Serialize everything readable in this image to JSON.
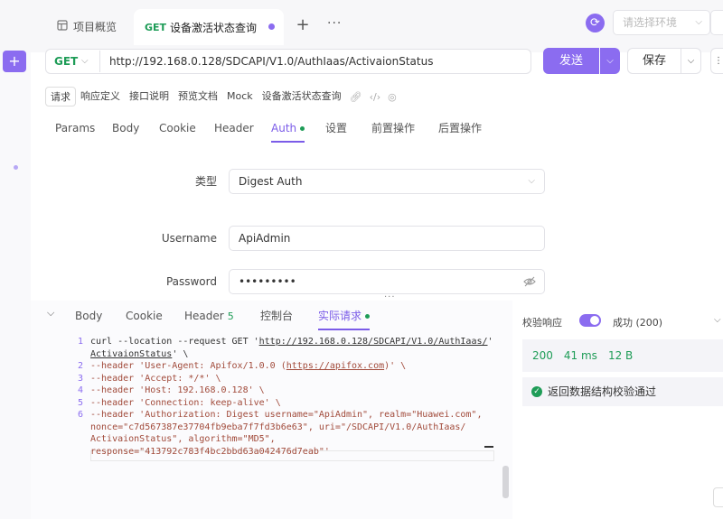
{
  "tabs": {
    "overview_label": "项目概览",
    "active_method": "GET",
    "active_label": "设备激活状态查询",
    "add": "+",
    "more": "···"
  },
  "env": {
    "placeholder": "请选择环境",
    "icon": "sync-icon"
  },
  "request": {
    "method": "GET",
    "url": "http://192.168.0.128/SDCAPI/V1.0/AuthIaas/ActivaionStatus",
    "send_label": "发送",
    "save_label": "保存"
  },
  "subtabs": [
    "请求",
    "响应定义",
    "接口说明",
    "预览文档",
    "Mock",
    "设备激活状态查询"
  ],
  "param_tabs": {
    "params": "Params",
    "body": "Body",
    "cookie": "Cookie",
    "header": "Header",
    "auth": "Auth",
    "settings": "设置",
    "pre": "前置操作",
    "post": "后置操作"
  },
  "auth": {
    "type_label": "类型",
    "type_value": "Digest Auth",
    "username_label": "Username",
    "username_value": "ApiAdmin",
    "password_label": "Password",
    "password_value": "•••••••••"
  },
  "bottom_tabs": {
    "body": "Body",
    "cookie": "Cookie",
    "header": "Header",
    "header_count": "5",
    "console": "控制台",
    "actual": "实际请求"
  },
  "code_lines": [
    {
      "n": "1",
      "segments": [
        "curl --location --request GET '",
        "http://192.168.0.128/SDCAPI/V1.0/AuthIaas/",
        "'"
      ]
    },
    {
      "n": "",
      "segments": [
        "",
        "ActivaionStatus",
        "' \\"
      ]
    },
    {
      "n": "2",
      "segments": [
        "--header 'User-Agent: Apifox/1.0.0 (",
        "https://apifox.com",
        ")' \\"
      ]
    },
    {
      "n": "3",
      "segments": [
        "--header 'Accept: */*' \\",
        "",
        ""
      ]
    },
    {
      "n": "4",
      "segments": [
        "--header 'Host: 192.168.0.128' \\",
        "",
        ""
      ]
    },
    {
      "n": "5",
      "segments": [
        "--header 'Connection: keep-alive' \\",
        "",
        ""
      ]
    },
    {
      "n": "6",
      "segments": [
        "--header 'Authorization: Digest username=\"ApiAdmin\", realm=\"Huawei.com\",",
        "",
        ""
      ]
    },
    {
      "n": "",
      "segments": [
        "nonce=\"c7d567387e37704fb9eba7f7fd3b6e63\", uri=\"/SDCAPI/V1.0/AuthIaas/",
        "",
        ""
      ]
    },
    {
      "n": "",
      "segments": [
        "ActivaionStatus\", algorithm=\"MD5\",",
        "",
        ""
      ]
    },
    {
      "n": "",
      "segments": [
        "response=\"413792c783f4bc2bbd63a042476d7eab\"'",
        "",
        ""
      ]
    }
  ],
  "result": {
    "verify_label": "校验响应",
    "success_label": "成功 (200)",
    "status": "200",
    "time": "41 ms",
    "size": "12 B",
    "valid_msg": "返回数据结构校验通过"
  }
}
